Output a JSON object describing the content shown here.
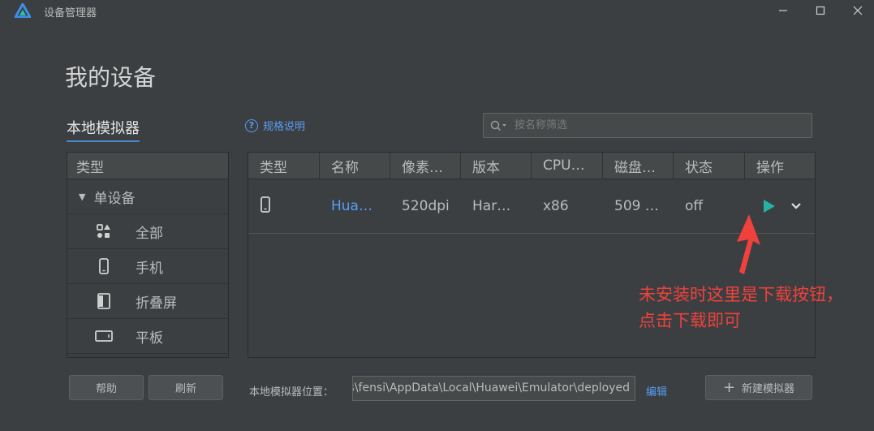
{
  "window": {
    "title": "设备管理器",
    "minimize": "–",
    "maximize": "☐",
    "close": "✕"
  },
  "page": {
    "title": "我的设备",
    "tab_local": "本地模拟器",
    "help_link": "规格说明",
    "filter_placeholder": "按名称筛选"
  },
  "sidebar": {
    "header": "类型",
    "group": "单设备",
    "items": [
      {
        "label": "全部",
        "icon": "grid-shapes-icon"
      },
      {
        "label": "手机",
        "icon": "phone-icon"
      },
      {
        "label": "折叠屏",
        "icon": "foldable-icon"
      },
      {
        "label": "平板",
        "icon": "tablet-icon"
      }
    ]
  },
  "table": {
    "columns": [
      "类型",
      "名称",
      "像素…",
      "版本",
      "CPU…",
      "磁盘…",
      "状态",
      "操作"
    ],
    "rows": [
      {
        "type_icon": "phone-icon",
        "name": "Hua…",
        "density": "520dpi",
        "version": "Har…",
        "cpu": "x86",
        "disk": "509 …",
        "status": "off"
      }
    ]
  },
  "annotation": {
    "line1": "未安装时这里是下载按钮，",
    "line2": "点击下载即可"
  },
  "footer": {
    "help_button": "帮助",
    "refresh_button": "刷新",
    "location_label": "本地模拟器位置：",
    "location_value": "C:\\Users\\fensi\\AppData\\Local\\Huawei\\Emulator\\deployed",
    "edit_link": "编辑",
    "new_button": "新建模拟器"
  },
  "colors": {
    "background": "#3c3f41",
    "accent": "#589df6",
    "play": "#27b1a3",
    "annotation": "#f0413c"
  }
}
